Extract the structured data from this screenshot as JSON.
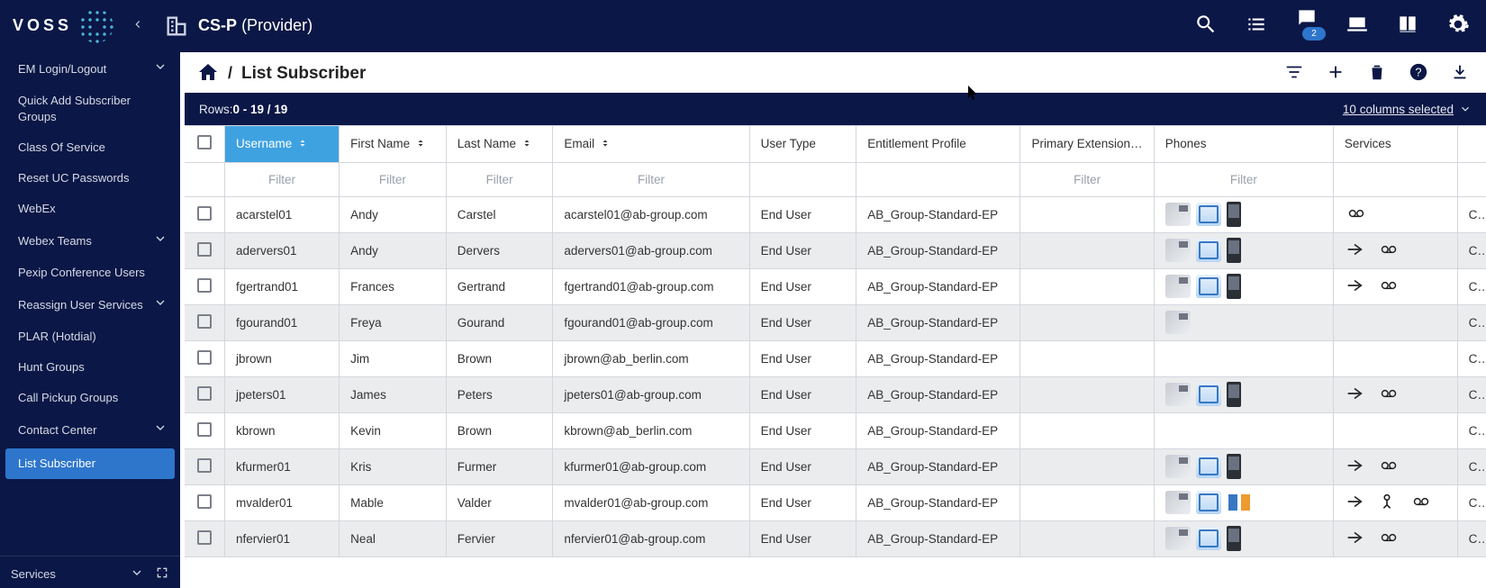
{
  "header": {
    "logo_text": "VOSS",
    "org_name_bold": "CS-P",
    "org_name_rest": "(Provider)",
    "badge_count": "2"
  },
  "sidebar": {
    "items": [
      {
        "label": "EM Login/Logout",
        "expandable": true,
        "selected": false
      },
      {
        "label": "Quick Add Subscriber Groups",
        "expandable": false,
        "selected": false
      },
      {
        "label": "Class Of Service",
        "expandable": false,
        "selected": false
      },
      {
        "label": "Reset UC Passwords",
        "expandable": false,
        "selected": false
      },
      {
        "label": "WebEx",
        "expandable": false,
        "selected": false
      },
      {
        "label": "Webex Teams",
        "expandable": true,
        "selected": false
      },
      {
        "label": "Pexip Conference Users",
        "expandable": false,
        "selected": false
      },
      {
        "label": "Reassign User Services",
        "expandable": true,
        "selected": false
      },
      {
        "label": "PLAR (Hotdial)",
        "expandable": false,
        "selected": false
      },
      {
        "label": "Hunt Groups",
        "expandable": false,
        "selected": false
      },
      {
        "label": "Call Pickup Groups",
        "expandable": false,
        "selected": false
      },
      {
        "label": "Contact Center",
        "expandable": true,
        "selected": false
      },
      {
        "label": "List Subscriber",
        "expandable": false,
        "selected": true
      }
    ],
    "bottom_label": "Services"
  },
  "main": {
    "page_title": "List Subscriber",
    "rows_label": "Rows: ",
    "rows_count": "0 - 19 / 19",
    "columns_selected": "10 columns selected",
    "filter_placeholder": "Filter",
    "columns": [
      "Username",
      "First Name",
      "Last Name",
      "Email",
      "User Type",
      "Entitlement Profile",
      "Primary Extension",
      "Phones",
      "Services"
    ],
    "filterable": [
      true,
      true,
      true,
      true,
      false,
      false,
      true,
      true,
      false
    ],
    "sorted_column": 0,
    "rows": [
      {
        "username": "acarstel01",
        "first": "Andy",
        "last": "Carstel",
        "email": "acarstel01@ab-group.com",
        "utype": "End User",
        "ent": "AB_Group-Standard-EP",
        "prim": "",
        "phones": [
          "desk",
          "soft",
          "mobile"
        ],
        "svc": [
          "vm"
        ],
        "tail": "Cl"
      },
      {
        "username": "adervers01",
        "first": "Andy",
        "last": "Dervers",
        "email": "adervers01@ab-group.com",
        "utype": "End User",
        "ent": "AB_Group-Standard-EP",
        "prim": "",
        "phones": [
          "desk",
          "soft",
          "mobile"
        ],
        "svc": [
          "arrow",
          "vm"
        ],
        "tail": "Cl"
      },
      {
        "username": "fgertrand01",
        "first": "Frances",
        "last": "Gertrand",
        "email": "fgertrand01@ab-group.com",
        "utype": "End User",
        "ent": "AB_Group-Standard-EP",
        "prim": "",
        "phones": [
          "desk",
          "soft",
          "mobile"
        ],
        "svc": [
          "arrow",
          "vm"
        ],
        "tail": "Cl"
      },
      {
        "username": "fgourand01",
        "first": "Freya",
        "last": "Gourand",
        "email": "fgourand01@ab-group.com",
        "utype": "End User",
        "ent": "AB_Group-Standard-EP",
        "prim": "",
        "phones": [
          "desk"
        ],
        "svc": [],
        "tail": "Cl"
      },
      {
        "username": "jbrown",
        "first": "Jim",
        "last": "Brown",
        "email": "jbrown@ab_berlin.com",
        "utype": "End User",
        "ent": "AB_Group-Standard-EP",
        "prim": "",
        "phones": [],
        "svc": [],
        "tail": "Cl"
      },
      {
        "username": "jpeters01",
        "first": "James",
        "last": "Peters",
        "email": "jpeters01@ab-group.com",
        "utype": "End User",
        "ent": "AB_Group-Standard-EP",
        "prim": "",
        "phones": [
          "desk",
          "soft",
          "mobile"
        ],
        "svc": [
          "arrow",
          "vm"
        ],
        "tail": "Cl"
      },
      {
        "username": "kbrown",
        "first": "Kevin",
        "last": "Brown",
        "email": "kbrown@ab_berlin.com",
        "utype": "End User",
        "ent": "AB_Group-Standard-EP",
        "prim": "",
        "phones": [],
        "svc": [],
        "tail": "Cl"
      },
      {
        "username": "kfurmer01",
        "first": "Kris",
        "last": "Furmer",
        "email": "kfurmer01@ab-group.com",
        "utype": "End User",
        "ent": "AB_Group-Standard-EP",
        "prim": "",
        "phones": [
          "desk",
          "soft",
          "mobile"
        ],
        "svc": [
          "arrow",
          "vm"
        ],
        "tail": "Cl"
      },
      {
        "username": "mvalder01",
        "first": "Mable",
        "last": "Valder",
        "email": "mvalder01@ab-group.com",
        "utype": "End User",
        "ent": "AB_Group-Standard-EP",
        "prim": "",
        "phones": [
          "desk",
          "soft",
          "dual"
        ],
        "svc": [
          "arrow",
          "person",
          "vm"
        ],
        "tail": "Cl"
      },
      {
        "username": "nfervier01",
        "first": "Neal",
        "last": "Fervier",
        "email": "nfervier01@ab-group.com",
        "utype": "End User",
        "ent": "AB_Group-Standard-EP",
        "prim": "",
        "phones": [
          "desk",
          "soft",
          "mobile"
        ],
        "svc": [
          "arrow",
          "vm"
        ],
        "tail": "Cl"
      }
    ]
  }
}
